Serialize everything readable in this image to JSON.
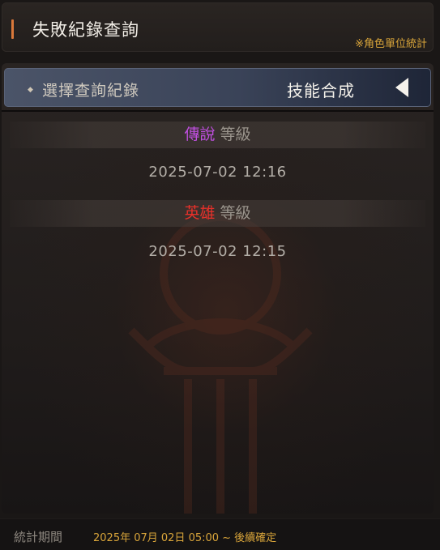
{
  "header": {
    "title": "失敗紀錄查詢",
    "note": "※角色單位統計"
  },
  "selector": {
    "label": "選擇查詢紀錄",
    "value": "技能合成"
  },
  "records": [
    {
      "grade": "傳說",
      "grade_color": "#c04fe0",
      "level_label": "等級",
      "time": "2025-07-02 12:16"
    },
    {
      "grade": "英雄",
      "grade_color": "#e8302a",
      "level_label": "等級",
      "time": "2025-07-02 12:15"
    }
  ],
  "footer": {
    "label": "統計期間",
    "value": "2025年 07月 02日 05:00 ~ 後續確定"
  },
  "colors": {
    "accent": "#d9783a",
    "note": "#d9a53a",
    "selector_bg": "#3a4358"
  }
}
